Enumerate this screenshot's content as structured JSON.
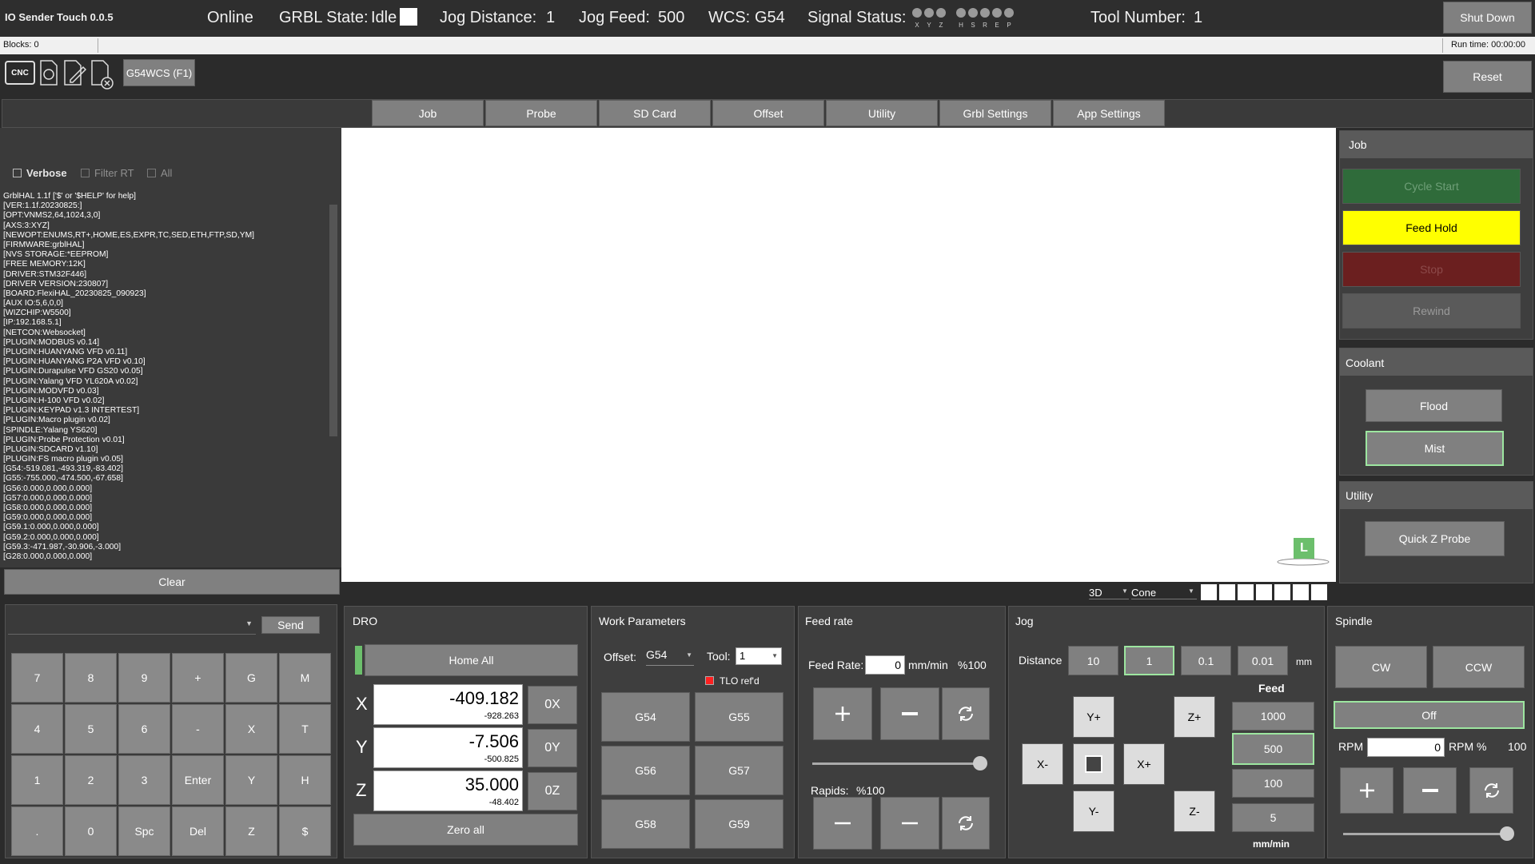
{
  "header": {
    "app_title": "IO Sender Touch 0.0.5",
    "connection": "Online",
    "grbl_state_label": "GRBL State:",
    "grbl_state": "Idle",
    "jog_distance_label": "Jog Distance:",
    "jog_distance": "1",
    "jog_feed_label": "Jog Feed:",
    "jog_feed": "500",
    "wcs_label": "WCS:",
    "wcs": "G54",
    "signal_label": "Signal Status:",
    "signal_groups": [
      [
        "X",
        "Y",
        "Z"
      ],
      [
        "H",
        "S",
        "R",
        "E",
        "P"
      ]
    ],
    "tool_label": "Tool Number:",
    "tool_number": "1",
    "shutdown": "Shut Down",
    "reset": "Reset"
  },
  "status": {
    "blocks": "Blocks: 0",
    "runtime": "Run time: 00:00:00"
  },
  "toolbar": {
    "cnc_icon": "CNC",
    "wcs_button": "G54WCS (F1)"
  },
  "tabs": [
    "Job",
    "Probe",
    "SD Card",
    "Offset",
    "Utility",
    "Grbl Settings",
    "App Settings"
  ],
  "console": {
    "verbose": "Verbose",
    "filter": "Filter RT",
    "all": "All",
    "clear": "Clear",
    "send": "Send",
    "lines": [
      "GrblHAL 1.1f ['$' or '$HELP' for help]",
      "[VER:1.1f.20230825:]",
      "[OPT:VNMS2,64,1024,3,0]",
      "[AXS:3:XYZ]",
      "[NEWOPT:ENUMS,RT+,HOME,ES,EXPR,TC,SED,ETH,FTP,SD,YM]",
      "[FIRMWARE:grblHAL]",
      "[NVS STORAGE:*EEPROM]",
      "[FREE MEMORY:12K]",
      "[DRIVER:STM32F446]",
      "[DRIVER VERSION:230807]",
      "[BOARD:FlexiHAL_20230825_090923]",
      "[AUX IO:5,6,0,0]",
      "[WIZCHIP:W5500]",
      "[IP:192.168.5.1]",
      "[NETCON:Websocket]",
      "[PLUGIN:MODBUS v0.14]",
      "[PLUGIN:HUANYANG VFD v0.11]",
      "[PLUGIN:HUANYANG P2A VFD v0.10]",
      "[PLUGIN:Durapulse VFD GS20 v0.05]",
      "[PLUGIN:Yalang VFD YL620A v0.02]",
      "[PLUGIN:MODVFD v0.03]",
      "[PLUGIN:H-100 VFD v0.02]",
      "[PLUGIN:KEYPAD v1.3 INTERTEST]",
      "[PLUGIN:Macro plugin v0.02]",
      "[SPINDLE:Yalang YS620]",
      "[PLUGIN:Probe Protection v0.01]",
      "[PLUGIN:SDCARD v1.10]",
      "[PLUGIN:FS macro plugin v0.05]",
      "[G54:-519.081,-493.319,-83.402]",
      "[G55:-755.000,-474.500,-67.658]",
      "[G56:0.000,0.000,0.000]",
      "[G57:0.000,0.000,0.000]",
      "[G58:0.000,0.000,0.000]",
      "[G59:0.000,0.000,0.000]",
      "[G59.1:0.000,0.000,0.000]",
      "[G59.2:0.000,0.000,0.000]",
      "[G59.3:-471.987,-30.906,-3.000]",
      "[G28:0.000,0.000,0.000]"
    ]
  },
  "keypad": [
    [
      "7",
      "8",
      "9",
      "+",
      "G",
      "M"
    ],
    [
      "4",
      "5",
      "6",
      "-",
      "X",
      "T"
    ],
    [
      "1",
      "2",
      "3",
      "Enter",
      "Y",
      "H"
    ],
    [
      ".",
      "0",
      "Spc",
      "Del",
      "Z",
      "$"
    ]
  ],
  "viewer": {
    "mode": "3D",
    "tool_shape": "Cone",
    "badge": "L"
  },
  "dro": {
    "title": "DRO",
    "home_all": "Home All",
    "zero_all": "Zero all",
    "axes": [
      {
        "label": "X",
        "value": "-409.182",
        "machine": "-928.263",
        "zero": "0X"
      },
      {
        "label": "Y",
        "value": "-7.506",
        "machine": "-500.825",
        "zero": "0Y"
      },
      {
        "label": "Z",
        "value": "35.000",
        "machine": "-48.402",
        "zero": "0Z"
      }
    ]
  },
  "work": {
    "title": "Work Parameters",
    "offset_label": "Offset:",
    "offset": "G54",
    "tool_label": "Tool:",
    "tool": "1",
    "tlo": "TLO ref'd",
    "buttons": [
      "G54",
      "G55",
      "G56",
      "G57",
      "G58",
      "G59"
    ]
  },
  "feedrate": {
    "title": "Feed rate",
    "label": "Feed Rate:",
    "value": "0",
    "unit": "mm/min",
    "percent": "%100",
    "rapids_label": "Rapids:",
    "rapids_percent": "%100",
    "override_level": 1.0
  },
  "jog": {
    "title": "Jog",
    "distance_label": "Distance",
    "distances": [
      "10",
      "1",
      "0.1",
      "0.01"
    ],
    "distance_unit": "mm",
    "feed_label": "Feed",
    "feeds": [
      "1000",
      "500",
      "100",
      "5"
    ],
    "feed_unit": "mm/min",
    "buttons": {
      "yp": "Y+",
      "ym": "Y-",
      "xm": "X-",
      "xp": "X+",
      "zp": "Z+",
      "zm": "Z-"
    }
  },
  "spindle": {
    "title": "Spindle",
    "cw": "CW",
    "ccw": "CCW",
    "off": "Off",
    "rpm_label": "RPM",
    "rpm_value": "0",
    "rpm_pct_label": "RPM %",
    "rpm_pct": "100",
    "override_level": 1.0
  },
  "right": {
    "job_title": "Job",
    "cycle_start": "Cycle Start",
    "feed_hold": "Feed Hold",
    "stop": "Stop",
    "rewind": "Rewind",
    "coolant_title": "Coolant",
    "flood": "Flood",
    "mist": "Mist",
    "utility_title": "Utility",
    "quick_z": "Quick Z Probe"
  },
  "colors": {
    "cycle_start": "#2f6b3a",
    "feed_hold": "#ffff00",
    "stop": "#6b1f1f",
    "active_border": "#9de6a0"
  }
}
